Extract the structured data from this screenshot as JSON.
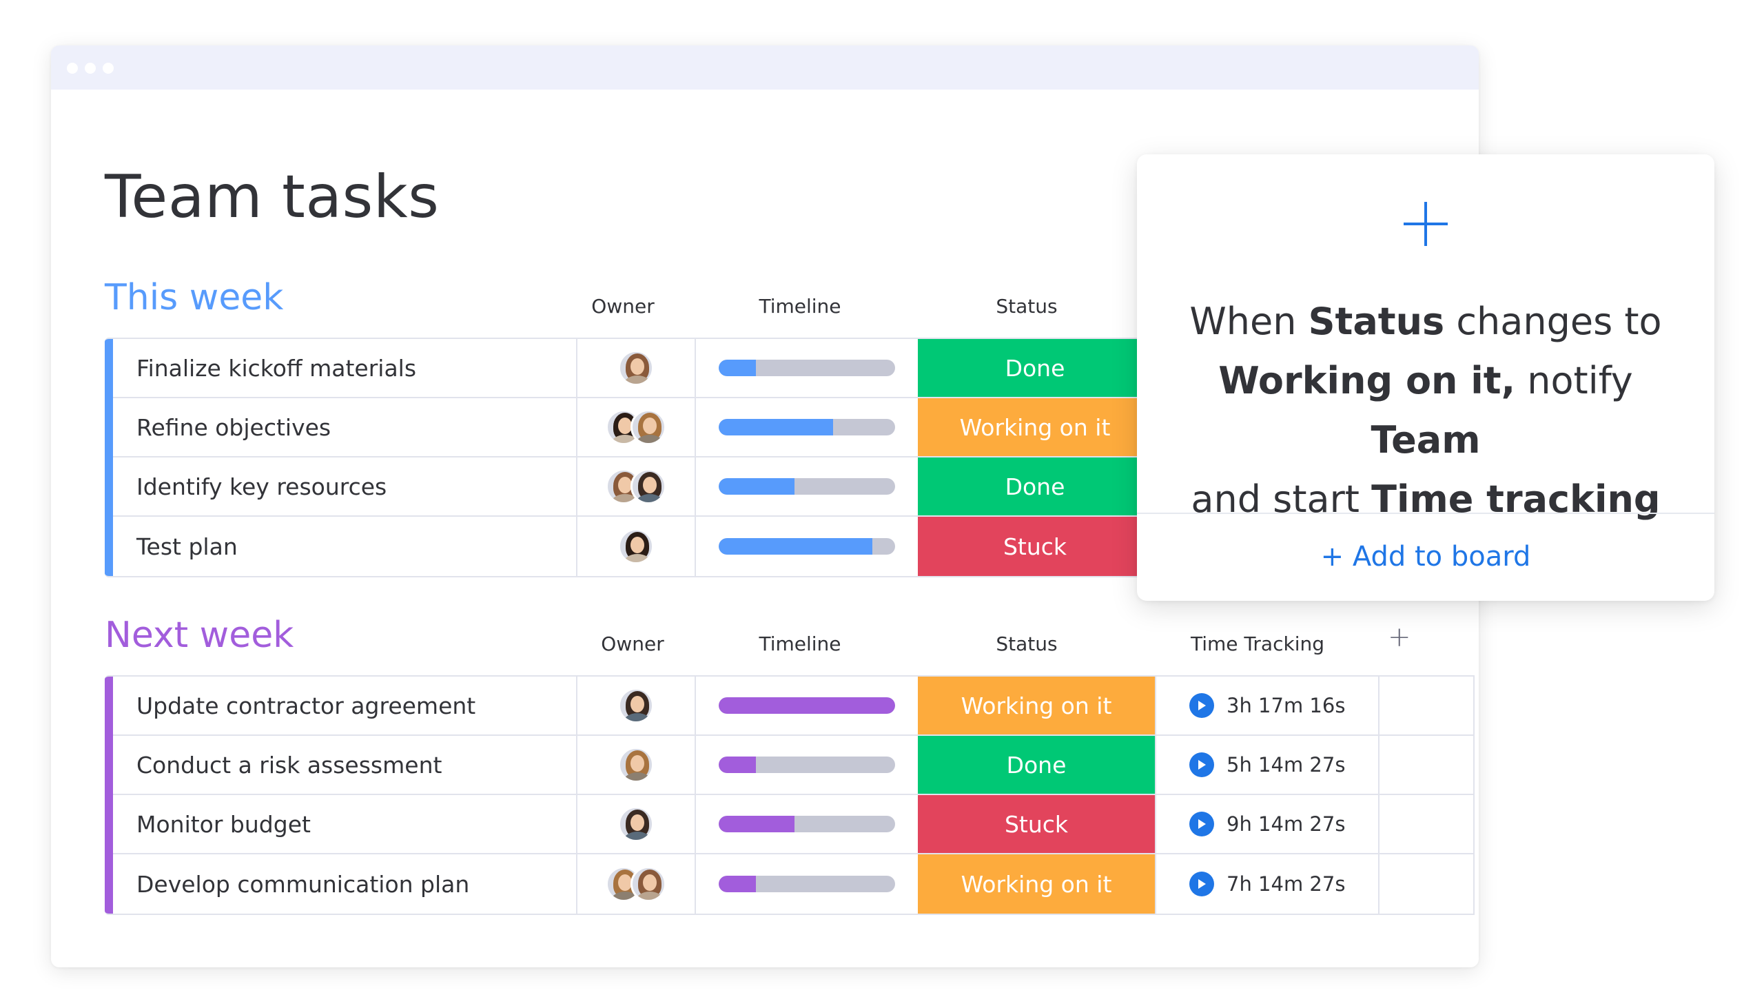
{
  "page_title": "Team tasks",
  "colors": {
    "this_week": "#579bfc",
    "next_week": "#a25ddc",
    "done": "#00c875",
    "working": "#fdab3d",
    "stuck": "#e2445c",
    "timeline_empty": "#c5c7d4",
    "accent_blue": "#1f76e6"
  },
  "groups": [
    {
      "title": "This week",
      "color": "#579bfc",
      "columns": {
        "owner": "Owner",
        "timeline": "Timeline",
        "status": "Status"
      },
      "rows": [
        {
          "task": "Finalize kickoff materials",
          "owners": 1,
          "progress": 0.21,
          "status": "Done",
          "status_color": "#00c875"
        },
        {
          "task": "Refine objectives",
          "owners": 2,
          "progress": 0.65,
          "status": "Working on it",
          "status_color": "#fdab3d"
        },
        {
          "task": "Identify key resources",
          "owners": 2,
          "progress": 0.43,
          "status": "Done",
          "status_color": "#00c875"
        },
        {
          "task": "Test plan",
          "owners": 1,
          "progress": 0.87,
          "status": "Stuck",
          "status_color": "#e2445c"
        }
      ]
    },
    {
      "title": "Next week",
      "color": "#a25ddc",
      "columns": {
        "owner": "Owner",
        "timeline": "Timeline",
        "status": "Status",
        "time_tracking": "Time Tracking",
        "add": "+"
      },
      "rows": [
        {
          "task": "Update contractor agreement",
          "owners": 1,
          "progress": 1.0,
          "status": "Working on it",
          "status_color": "#fdab3d",
          "time": "3h 17m 16s"
        },
        {
          "task": "Conduct a risk assessment",
          "owners": 1,
          "progress": 0.21,
          "status": "Done",
          "status_color": "#00c875",
          "time": "5h 14m 27s"
        },
        {
          "task": "Monitor budget",
          "owners": 1,
          "progress": 0.43,
          "status": "Stuck",
          "status_color": "#e2445c",
          "time": "9h 14m 27s"
        },
        {
          "task": "Develop communication plan",
          "owners": 2,
          "progress": 0.21,
          "status": "Working on it",
          "status_color": "#fdab3d",
          "time": "7h 14m 27s"
        }
      ]
    }
  ],
  "automation_card": {
    "line1_a": "When ",
    "line1_b": "Status",
    "line1_c": " changes to",
    "line2_a": "Working on it,",
    "line2_b": " notify ",
    "line2_c": "Team",
    "line3_a": "and start ",
    "line3_b": "Time tracking",
    "action": "+ Add to board"
  },
  "icons": {
    "add_column": "plus-icon",
    "card_plus": "plus-icon",
    "timer": "play-icon"
  }
}
